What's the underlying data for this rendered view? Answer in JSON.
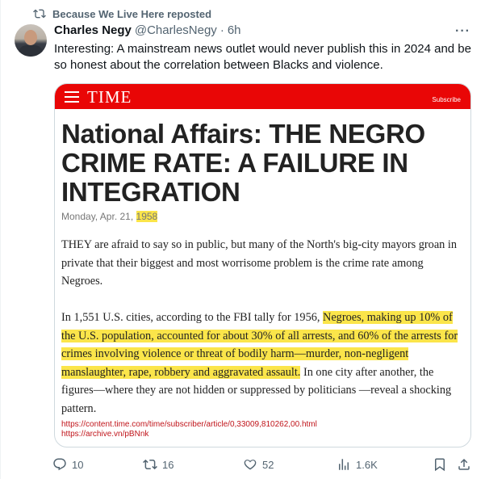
{
  "repost": {
    "text": "Because We Live Here reposted"
  },
  "author": {
    "name": "Charles Negy",
    "handle": "@CharlesNegy",
    "separator": "·",
    "time": "6h"
  },
  "more_label": "···",
  "tweet": {
    "text": "Interesting:  A mainstream news outlet would never publish this in 2024 and be so honest about the correlation between Blacks and violence."
  },
  "article": {
    "brand": "TIME",
    "subscribe": "Subscribe",
    "headline": "National Affairs: THE NEGRO CRIME RATE: A FAILURE IN INTEGRATION",
    "date_prefix": "Monday, Apr. 21, ",
    "date_year": "1958",
    "para1": "THEY are afraid to say so in public, but many of the North's big-city mayors groan in private that their biggest and most worrisome problem is the crime rate among Negroes.",
    "para2_pre": "In 1,551 U.S. cities, according to the FBI tally for 1956, ",
    "para2_highlight": "Negroes, making up 10% of the U.S. population, accounted for about 30% of all arrests, and 60% of the arrests for crimes involving violence or threat of bodily harm—murder, non-negligent manslaughter, rape, robbery and aggravated assault.",
    "para2_post": " In one city after another, the figures—where they are not hidden or suppressed by politicians —reveal a shocking pattern.",
    "link1": "https://content.time.com/time/subscriber/article/0,33009,810262,00.html",
    "link2": "https://archive.vn/pBNnk"
  },
  "actions": {
    "replies": "10",
    "reposts": "16",
    "likes": "52",
    "views": "1.6K"
  },
  "icons": [
    "repost-icon",
    "reply-icon",
    "like-icon",
    "views-icon",
    "bookmark-icon",
    "share-icon",
    "menu-icon"
  ]
}
